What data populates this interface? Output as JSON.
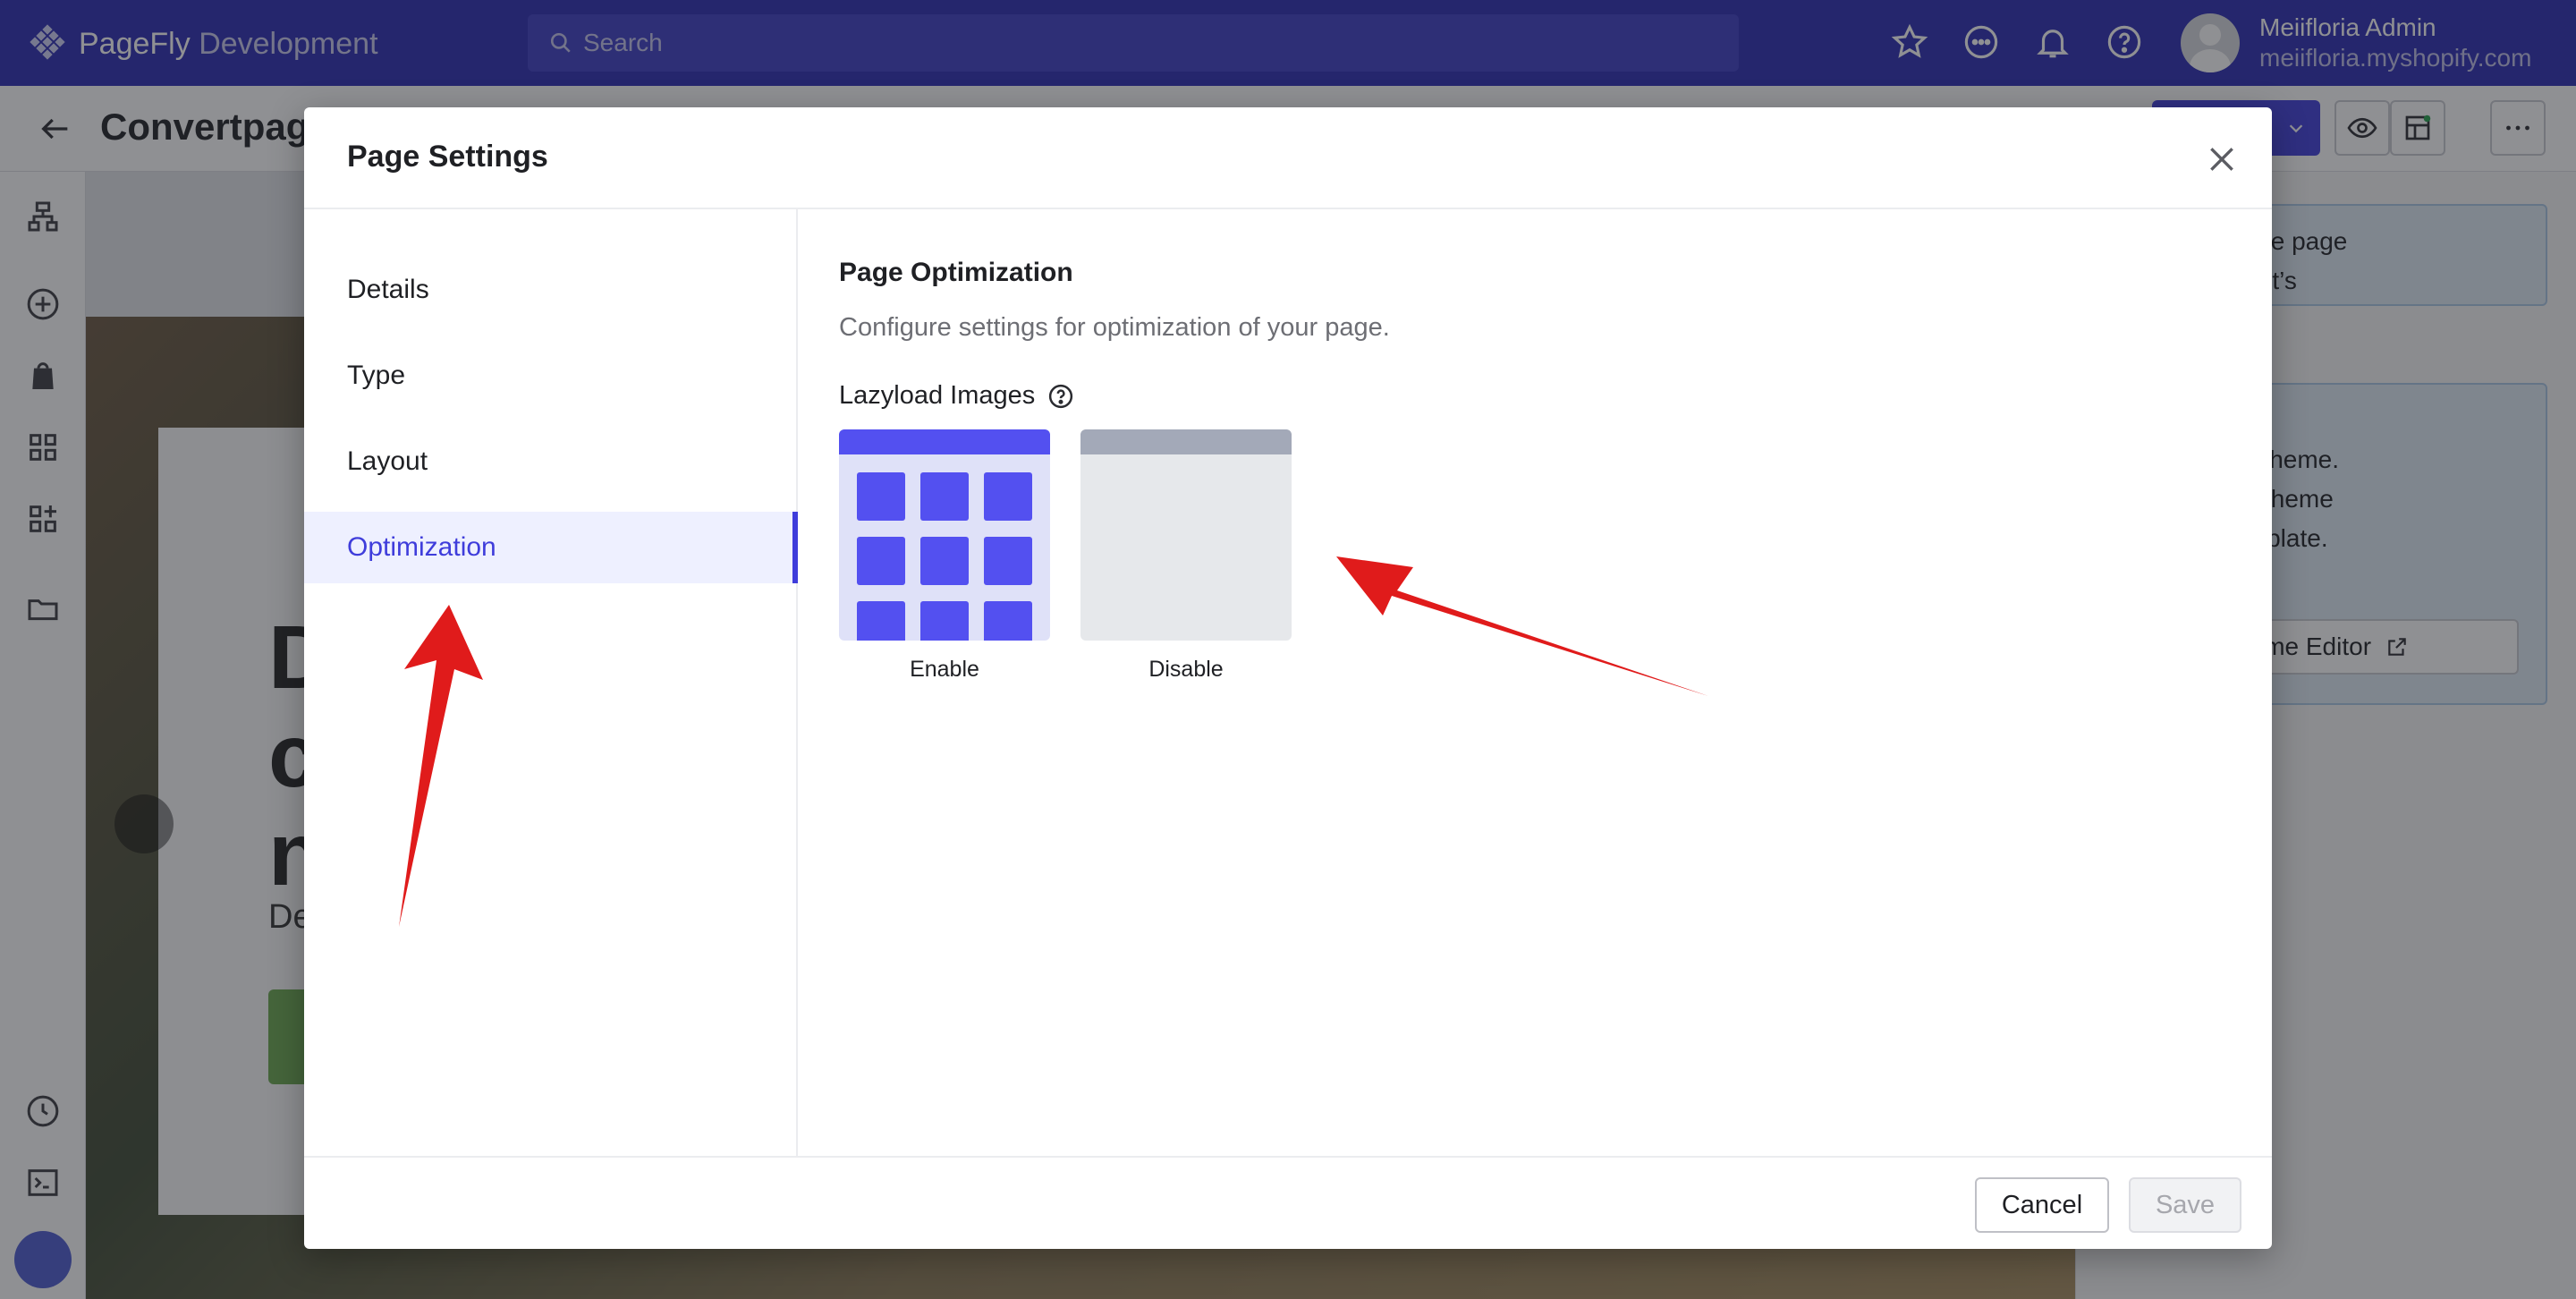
{
  "app": {
    "brand_name": "PageFly",
    "brand_suffix": "Development",
    "search_placeholder": "Search",
    "user_name": "Meiifloria Admin",
    "user_shop": "meiifloria.myshopify.com"
  },
  "page": {
    "title": "Convertpag"
  },
  "hero": {
    "heading_fragment": "D\nc\nn",
    "sub_fragment": "De"
  },
  "right_panel": {
    "info_1": "ement from the page\nhe left to see it’s\nhere.",
    "info_2": "ge works as a\nyour Shopify theme.\n Editor to edit theme\nthis page template.",
    "theme_editor_label": "Theme Editor"
  },
  "modal": {
    "title": "Page Settings",
    "nav": [
      {
        "label": "Details"
      },
      {
        "label": "Type"
      },
      {
        "label": "Layout"
      },
      {
        "label": "Optimization"
      }
    ],
    "active_nav": "Optimization",
    "section_title": "Page Optimization",
    "section_desc": "Configure settings for optimization of your page.",
    "lazyload_label": "Lazyload Images",
    "options": [
      {
        "label": "Enable"
      },
      {
        "label": "Disable"
      }
    ],
    "cancel_label": "Cancel",
    "save_label": "Save"
  },
  "colors": {
    "brand": "#2b2ab2",
    "accent": "#3f3ddb",
    "option_enable": "#5350f0",
    "option_disable": "#a3a9b8",
    "annotation_arrow": "#e01b1b"
  },
  "icons": [
    "pagefly-logo-icon",
    "search-icon",
    "star-icon",
    "chat-icon",
    "bell-icon",
    "help-icon",
    "back-arrow-icon",
    "eye-icon",
    "layout-icon",
    "more-icon",
    "close-icon",
    "chevron-down-icon",
    "external-link-icon"
  ]
}
